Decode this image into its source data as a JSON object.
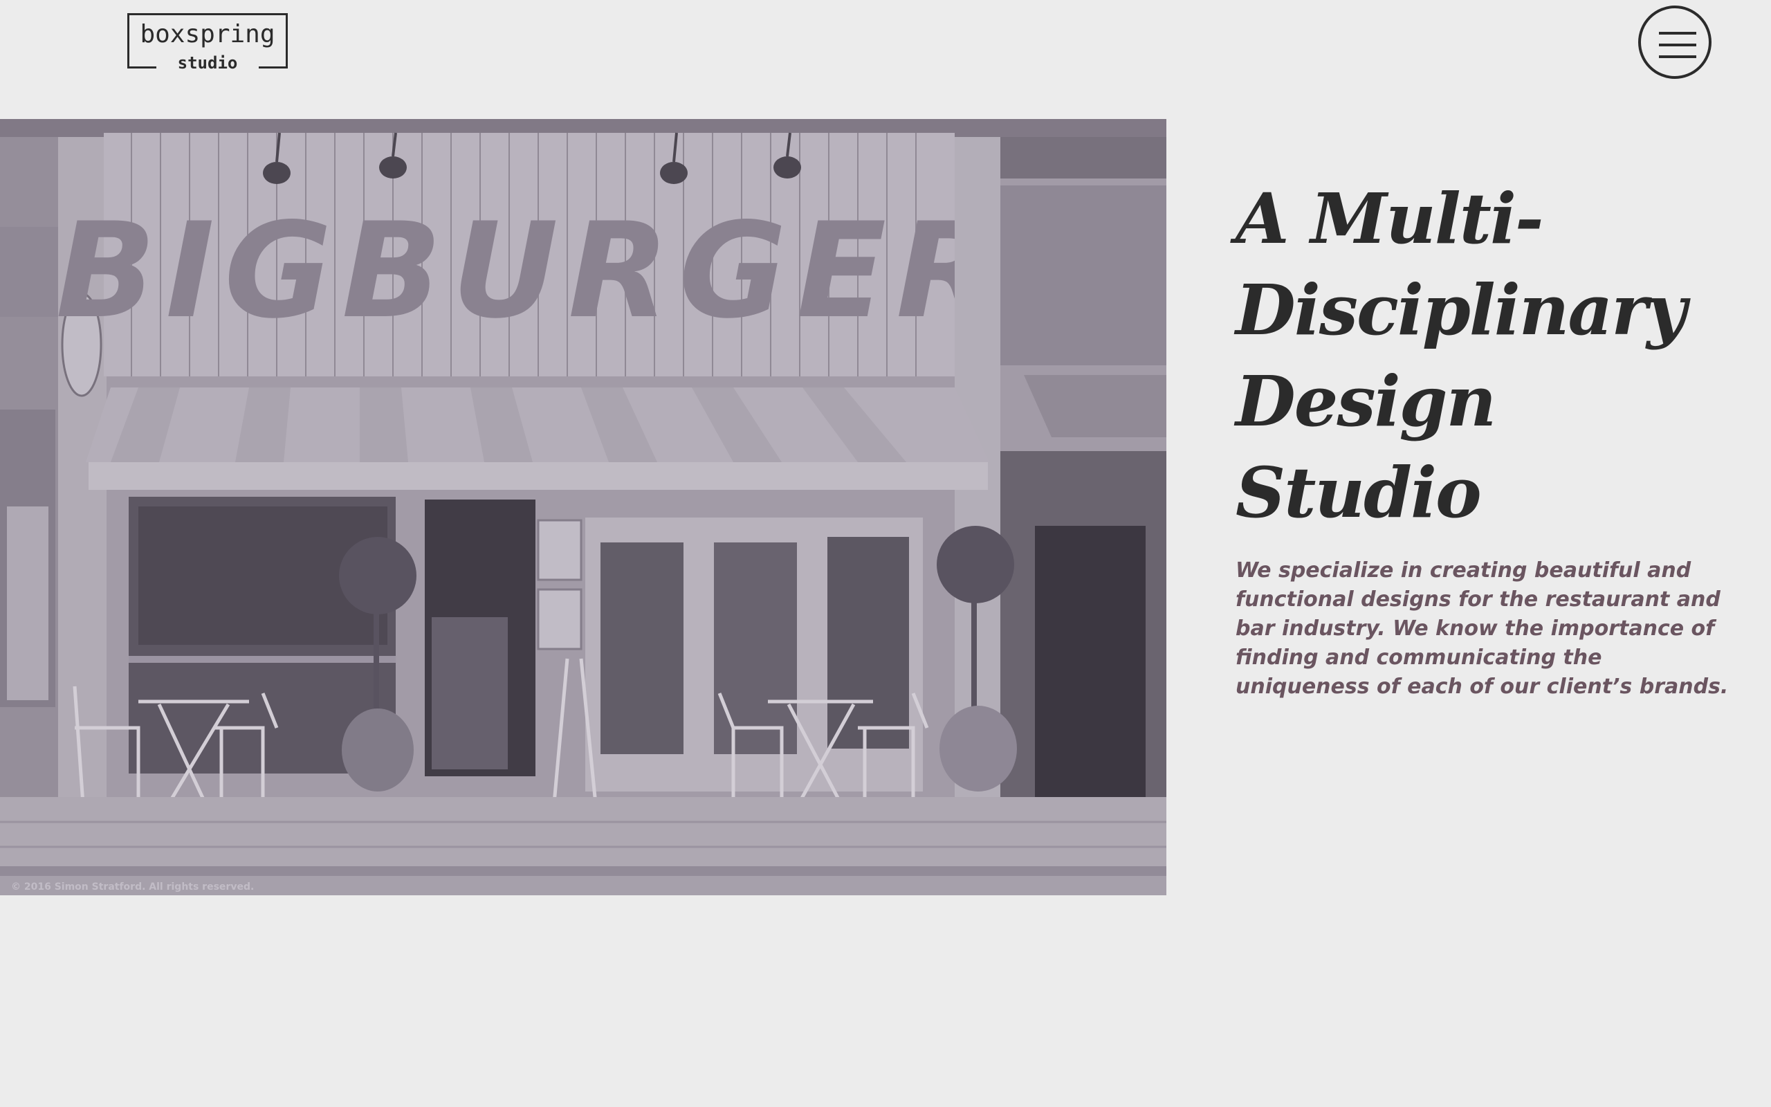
{
  "logo": {
    "main": "boxspring",
    "sub": "studio"
  },
  "menu": {
    "icon": "hamburger-menu-icon"
  },
  "hero": {
    "image_sign_text": "BIGBURGER",
    "image_caption": "© 2016 Simon Stratford. All rights reserved.",
    "headline": "A Multi-Disciplinary Design Studio",
    "description": "We specialize in creating beautiful and functional designs for the restaurant and bar industry. We know the importance of finding and communicating the uniqueness of each of our client’s brands."
  },
  "colors": {
    "background": "#ececec",
    "text_dark": "#2b2b2b",
    "text_accent": "#6a5560",
    "image_tint": "#9f98a3"
  }
}
